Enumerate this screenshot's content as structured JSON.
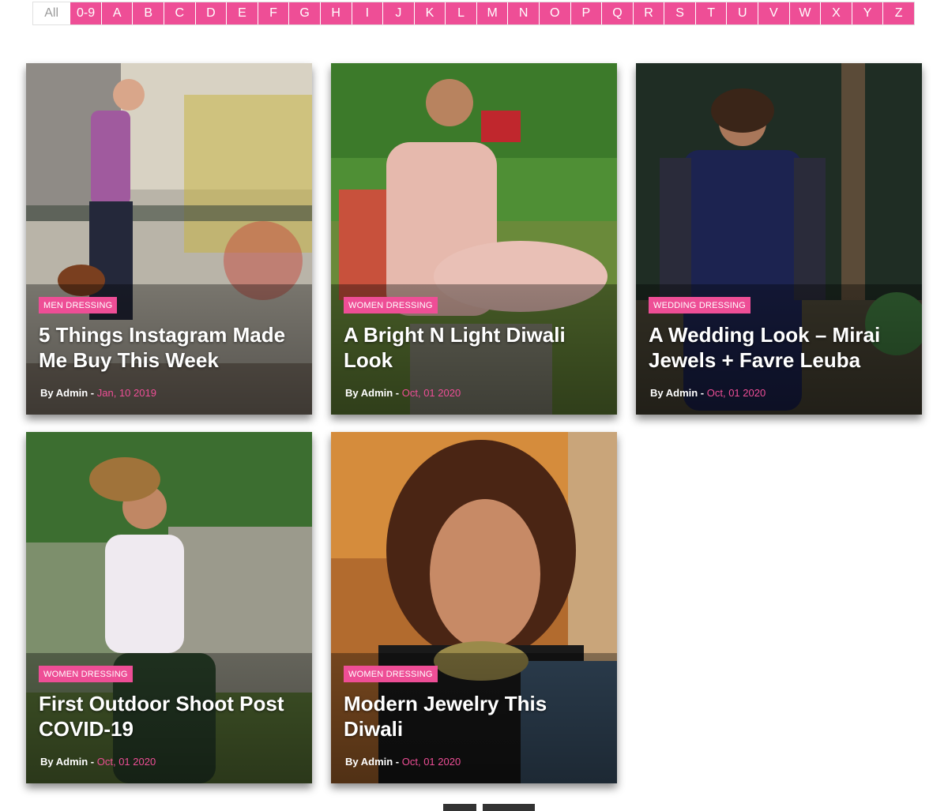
{
  "alphabet": [
    "All",
    "0-9",
    "A",
    "B",
    "C",
    "D",
    "E",
    "F",
    "G",
    "H",
    "I",
    "J",
    "K",
    "L",
    "M",
    "N",
    "O",
    "P",
    "Q",
    "R",
    "S",
    "T",
    "U",
    "V",
    "W",
    "X",
    "Y",
    "Z"
  ],
  "active_filter": "All",
  "colors": {
    "accent": "#ee4e96"
  },
  "cards": [
    {
      "category": "MEN DRESSING",
      "title": "5 Things Instagram Made Me Buy This Week",
      "author_prefix": "By Admin - ",
      "date": "Jan, 10 2019"
    },
    {
      "category": "WOMEN DRESSING",
      "title": "A Bright N Light Diwali Look",
      "author_prefix": "By Admin - ",
      "date": "Oct, 01 2020"
    },
    {
      "category": "WEDDING DRESSING",
      "title": "A Wedding Look – Mirai Jewels + Favre Leuba",
      "author_prefix": "By Admin - ",
      "date": "Oct, 01 2020"
    },
    {
      "category": "WOMEN DRESSING",
      "title": "First Outdoor Shoot Post COVID-19",
      "author_prefix": "By Admin - ",
      "date": "Oct, 01 2020"
    },
    {
      "category": "WOMEN DRESSING",
      "title": "Modern Jewelry This Diwali",
      "author_prefix": "By Admin - ",
      "date": "Oct, 01 2020"
    }
  ]
}
